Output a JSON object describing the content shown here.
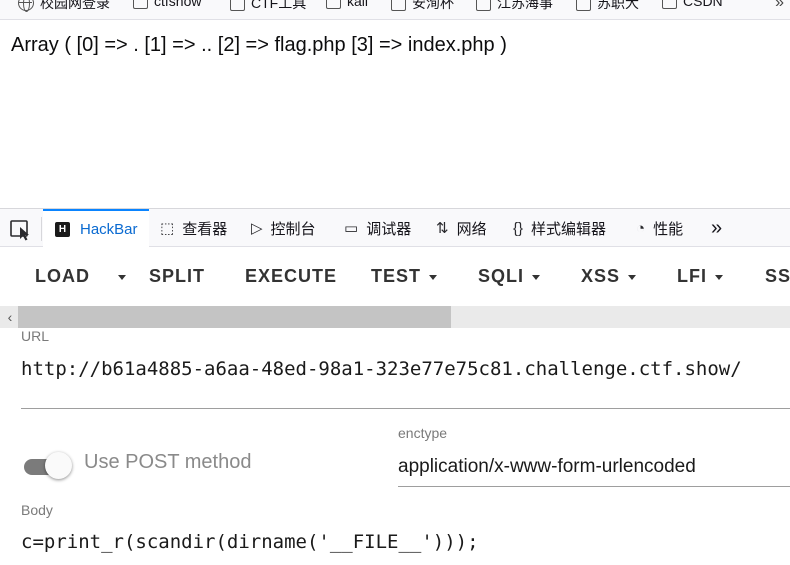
{
  "bookmarks": {
    "items": [
      {
        "label": "校园网登录",
        "icon": "globe-icon"
      },
      {
        "label": "ctfshow",
        "icon": "folder-icon"
      },
      {
        "label": "CTF工具",
        "icon": "folder-icon"
      },
      {
        "label": "kali",
        "icon": "folder-icon"
      },
      {
        "label": "安洵杯",
        "icon": "folder-icon"
      },
      {
        "label": "江苏海事",
        "icon": "folder-icon"
      },
      {
        "label": "苏职大",
        "icon": "folder-icon"
      },
      {
        "label": "CSDN",
        "icon": "folder-icon"
      }
    ],
    "overflow_icon": "»"
  },
  "page": {
    "output": "Array ( [0] => . [1] => .. [2] => flag.php [3] => index.php )"
  },
  "devtools": {
    "tabs": [
      {
        "label": "HackBar",
        "icon": "H",
        "active": true
      },
      {
        "label": "查看器",
        "icon": "⬚"
      },
      {
        "label": "控制台",
        "icon": "▷"
      },
      {
        "label": "调试器",
        "icon": "▭"
      },
      {
        "label": "网络",
        "icon": "⇅"
      },
      {
        "label": "样式编辑器",
        "icon": "{}"
      },
      {
        "label": "性能",
        "icon": "◔"
      }
    ],
    "overflow": "»"
  },
  "hackbar": {
    "buttons": [
      "LOAD",
      "SPLIT",
      "EXECUTE",
      "TEST",
      "SQLI",
      "XSS",
      "LFI",
      "SS"
    ],
    "url_label": "URL",
    "url_value": "http://b61a4885-a6aa-48ed-98a1-323e77e75c81.challenge.ctf.show/",
    "post_label": "Use POST method",
    "post_enabled": false,
    "enctype_label": "enctype",
    "enctype_value": "application/x-www-form-urlencoded",
    "body_label": "Body",
    "body_value": "c=print_r(scandir(dirname('__FILE__')));"
  },
  "colors": {
    "active_tab": "#0a84ff",
    "toggle_track": "#7b7b7b"
  }
}
